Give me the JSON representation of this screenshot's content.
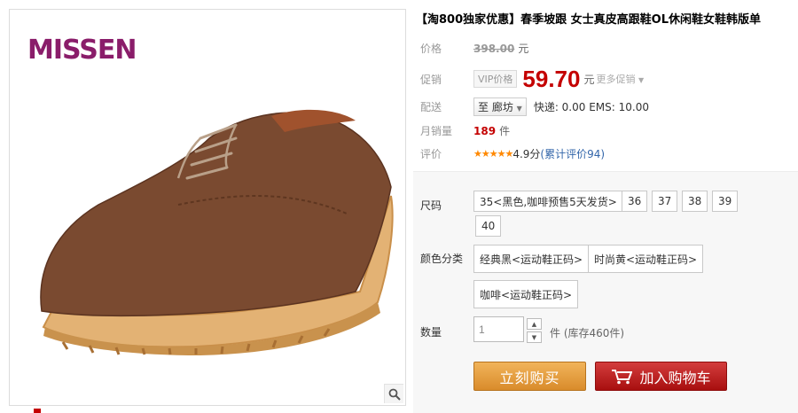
{
  "product": {
    "brand": "MISSEN",
    "title": "【淘800独家优惠】春季坡跟 女士真皮高跟鞋OL休闲鞋女鞋韩版单"
  },
  "price": {
    "label": "价格",
    "value": "398.00",
    "unit": "元"
  },
  "promo": {
    "label": "促销",
    "badge": "VIP价格",
    "value": "59.70",
    "unit": "元",
    "more": "更多促销"
  },
  "shipping": {
    "label": "配送",
    "location": "至 廊坊",
    "fee": "快递: 0.00 EMS: 10.00"
  },
  "sales": {
    "label": "月销量",
    "value": "189",
    "unit": "件"
  },
  "rating": {
    "label": "评价",
    "stars": "★★★★★",
    "score": "4.9分",
    "reviews": "(累计评价94)"
  },
  "size": {
    "label": "尺码",
    "options": [
      "35<黑色,咖啡预售5天发货>",
      "36",
      "37",
      "38",
      "39",
      "40"
    ]
  },
  "color": {
    "label": "颜色分类",
    "options": [
      "经典黑<运动鞋正码>",
      "时尚黄<运动鞋正码>",
      "咖啡<运动鞋正码>"
    ]
  },
  "quantity": {
    "label": "数量",
    "value": "1",
    "stock": "件 (库存460件)"
  },
  "buttons": {
    "buy": "立刻购买",
    "cart": "加入购物车"
  },
  "colors": {
    "brand": "#8a1d6a",
    "price_red": "#c40000",
    "buy_orange": "#e09a3a",
    "cart_red": "#b81f1f"
  }
}
